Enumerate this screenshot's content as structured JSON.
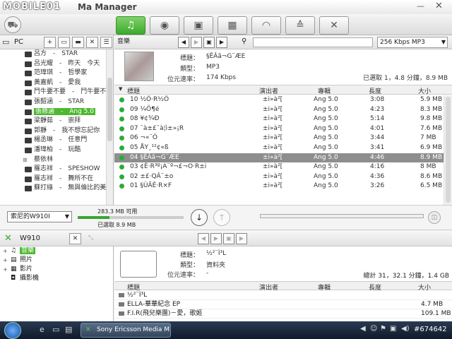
{
  "window": {
    "title": "Sony Ericsson Media Manager",
    "title_visible": "Ma Manager",
    "watermark": "MOBILE01"
  },
  "main_tabs": [
    {
      "icon": "music-icon",
      "glyph": "♫",
      "active": true
    },
    {
      "icon": "disc-icon",
      "glyph": "◉",
      "active": false
    },
    {
      "icon": "camera-icon",
      "glyph": "▣",
      "active": false
    },
    {
      "icon": "film-icon",
      "glyph": "▦",
      "active": false
    },
    {
      "icon": "rss-icon",
      "glyph": "◠",
      "active": false
    },
    {
      "icon": "sort-icon",
      "glyph": "≙",
      "active": false
    },
    {
      "icon": "tools-icon",
      "glyph": "✕",
      "active": false
    }
  ],
  "pc_panel": {
    "label": "PC",
    "folders": [
      {
        "label": "呂方　-　STAR",
        "selected": false
      },
      {
        "label": "呂光耀　-　昨天　今天　明天",
        "selected": false
      },
      {
        "label": "范瑋琪　-　哲學家",
        "selected": false
      },
      {
        "label": "黃嘉凱　-　愛我",
        "selected": false
      },
      {
        "label": "鬥牛要不要　-　鬥牛要不要",
        "selected": false
      },
      {
        "label": "張韶涵　-　STAR",
        "selected": false
      },
      {
        "label": "張懸涵　-　Ang 5.0",
        "selected": true
      },
      {
        "label": "梁靜茹　-　崇拜",
        "selected": false
      },
      {
        "label": "郭靜　-　我不想忘記你",
        "selected": false
      },
      {
        "label": "楊丞琳　-　任意門",
        "selected": false
      },
      {
        "label": "潘瑋柏　-　玩酷",
        "selected": false
      },
      {
        "label": "蔡依林",
        "selected": false,
        "expandable": true
      },
      {
        "label": "羅志祥　-　SPESHOW",
        "selected": false
      },
      {
        "label": "羅志祥　-　舞所不在",
        "selected": false
      },
      {
        "label": "蘇打綠　-　無與倫比的美麗",
        "selected": false
      }
    ]
  },
  "library": {
    "header_label": "音樂",
    "bitrate": "256 Kbps MP3",
    "album": {
      "title_key": "標題：",
      "title_val": "§ÊÂã¬G¨ÆE",
      "type_key": "類型：",
      "type_val": "MP3",
      "bitrate_key": "位元速率：",
      "bitrate_val": "174 Kbps",
      "count": "已選取 1，4.8 分鐘，8.9 MB"
    },
    "columns": [
      "標題",
      "演出者",
      "專輯",
      "長度",
      "大小"
    ],
    "tracks": [
      {
        "n": "10",
        "title": "½Ö·R½Ö",
        "artist": "±i»à²[",
        "album": "Ang 5.0",
        "len": "3:08",
        "size": "5.9 MB",
        "sel": false
      },
      {
        "n": "09",
        "title": "¼Ö¶é",
        "artist": "±i»à²[",
        "album": "Ang 5.0",
        "len": "4:23",
        "size": "8.3 MB",
        "sel": false
      },
      {
        "n": "08",
        "title": "¥¢¾Ð",
        "artist": "±i»à²[",
        "album": "Ang 5.0",
        "len": "5:14",
        "size": "9.8 MB",
        "sel": false
      },
      {
        "n": "07",
        "title": "¯à±£¯à¦ì±»¡R",
        "artist": "±i»à²[",
        "album": "Ang 5.0",
        "len": "4:01",
        "size": "7.6 MB",
        "sel": false
      },
      {
        "n": "06",
        "title": "¬«¨Ó",
        "artist": "±i»à²[",
        "album": "Ang 5.0",
        "len": "3:44",
        "size": "7 MB",
        "sel": false
      },
      {
        "n": "05",
        "title": "ÅY¸¹²¢«ß",
        "artist": "±i»à²[",
        "album": "Ang 5.0",
        "len": "3:41",
        "size": "6.9 MB",
        "sel": false
      },
      {
        "n": "04",
        "title": "§ÊÂã¬G¨ÆE",
        "artist": "±i»à²[",
        "album": "Ang 5.0",
        "len": "4:46",
        "size": "8.9 MB",
        "sel": true
      },
      {
        "n": "03",
        "title": "¢È·R³º¡A¨º¬£¬O·R±i",
        "artist": "±i»à²[",
        "album": "Ang 5.0",
        "len": "4:16",
        "size": "8 MB",
        "sel": false
      },
      {
        "n": "02",
        "title": "±£·QÂ¨±o",
        "artist": "±i»à²[",
        "album": "Ang 5.0",
        "len": "4:36",
        "size": "8.6 MB",
        "sel": false
      },
      {
        "n": "01",
        "title": "§ÙÃÊ·R×F",
        "artist": "±i»à²[",
        "album": "Ang 5.0",
        "len": "3:26",
        "size": "6.5 MB",
        "sel": false
      }
    ]
  },
  "transfer": {
    "device_select": "索尼的W910I",
    "capacity_free": "283.3 MB 可用",
    "capacity_used": "已選取 8.9 MB",
    "capacity_fraction": 0.3
  },
  "device": {
    "name": "W910",
    "tree": [
      {
        "label": "音樂",
        "icon": "music-icon",
        "glyph": "♫",
        "selected": true,
        "pm": "+"
      },
      {
        "label": "照片",
        "icon": "photo-icon",
        "glyph": "▤",
        "selected": false,
        "pm": "+"
      },
      {
        "label": "影片",
        "icon": "film-icon",
        "glyph": "▦",
        "selected": false,
        "pm": "+"
      },
      {
        "label": "攝影機",
        "icon": "camera-icon",
        "glyph": "◘",
        "selected": false,
        "pm": ""
      }
    ],
    "info": {
      "title_key": "標題：",
      "title_val": "½²¨Ì³L",
      "type_key": "類型：",
      "type_val": "資料夾",
      "bitrate_key": "位元速率：",
      "bitrate_val": "-",
      "count": "總計 31，32.1 分鐘，1.4 GB"
    },
    "columns": [
      "標題",
      "演出者",
      "專輯",
      "長度",
      "大小"
    ],
    "rows": [
      {
        "name": "½²¨Ì³L",
        "size": ""
      },
      {
        "name": "ELLA-華華紀念 EP",
        "size": "4.7 MB"
      },
      {
        "name": "F.I.R(飛兒樂團)－愛，歌姬",
        "size": "109.1 MB"
      }
    ]
  },
  "taskbar": {
    "app_label": "Sony Ericsson Media M...",
    "tray_id": "#674642"
  }
}
